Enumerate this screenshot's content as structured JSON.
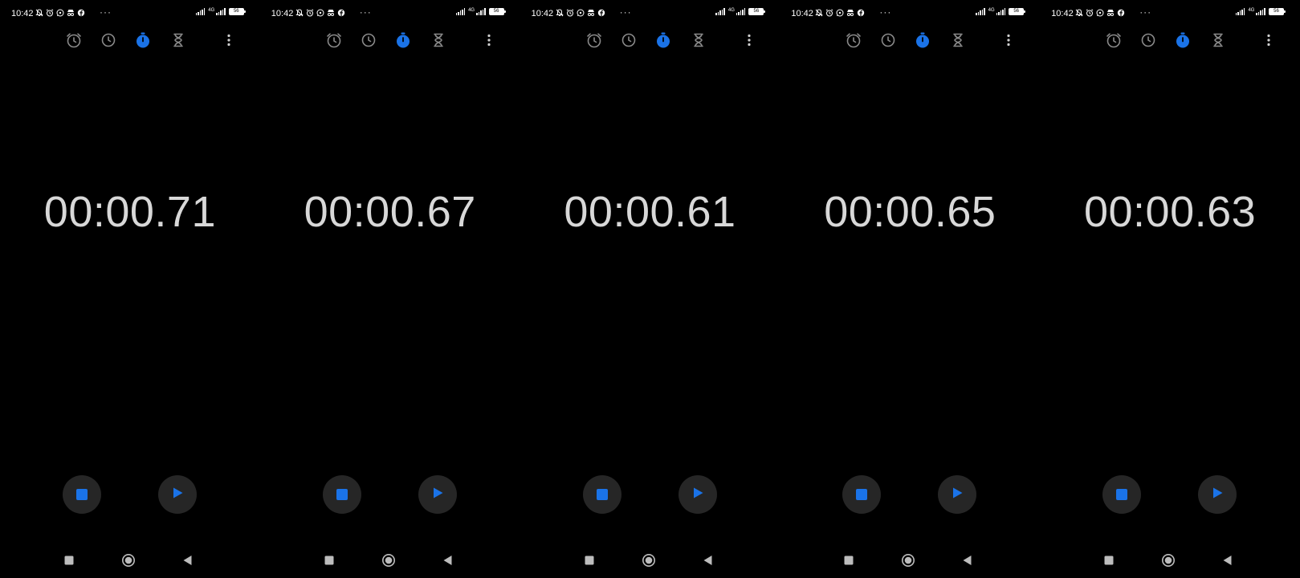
{
  "colors": {
    "accent": "#1a73e8",
    "inactive_icon": "#8a8a8a",
    "time_text": "#d8d8d8",
    "button_bg": "#262626",
    "nav_icon": "#bdbdbd",
    "background": "#000000"
  },
  "icons": {
    "tabs": [
      "alarm-clock-icon",
      "world-clock-icon",
      "stopwatch-icon",
      "hourglass-timer-icon"
    ],
    "more": "more-vertical-icon",
    "controls": [
      "stop-icon",
      "play-icon"
    ],
    "nav": [
      "recents-square-icon",
      "home-circle-icon",
      "back-triangle-icon"
    ]
  },
  "screens": [
    {
      "status": {
        "time": "10:42",
        "dots": "···",
        "network": "4G",
        "battery": "56"
      },
      "stopwatch": {
        "time": "00:00.71"
      }
    },
    {
      "status": {
        "time": "10:42",
        "dots": "···",
        "network": "4G",
        "battery": "56"
      },
      "stopwatch": {
        "time": "00:00.67"
      }
    },
    {
      "status": {
        "time": "10:42",
        "dots": "···",
        "network": "4G",
        "battery": "56"
      },
      "stopwatch": {
        "time": "00:00.61"
      }
    },
    {
      "status": {
        "time": "10:42",
        "dots": "···",
        "network": "4G",
        "battery": "56"
      },
      "stopwatch": {
        "time": "00:00.65"
      }
    },
    {
      "status": {
        "time": "10:42",
        "dots": "···",
        "network": "4G",
        "battery": "56"
      },
      "stopwatch": {
        "time": "00:00.63"
      }
    }
  ]
}
